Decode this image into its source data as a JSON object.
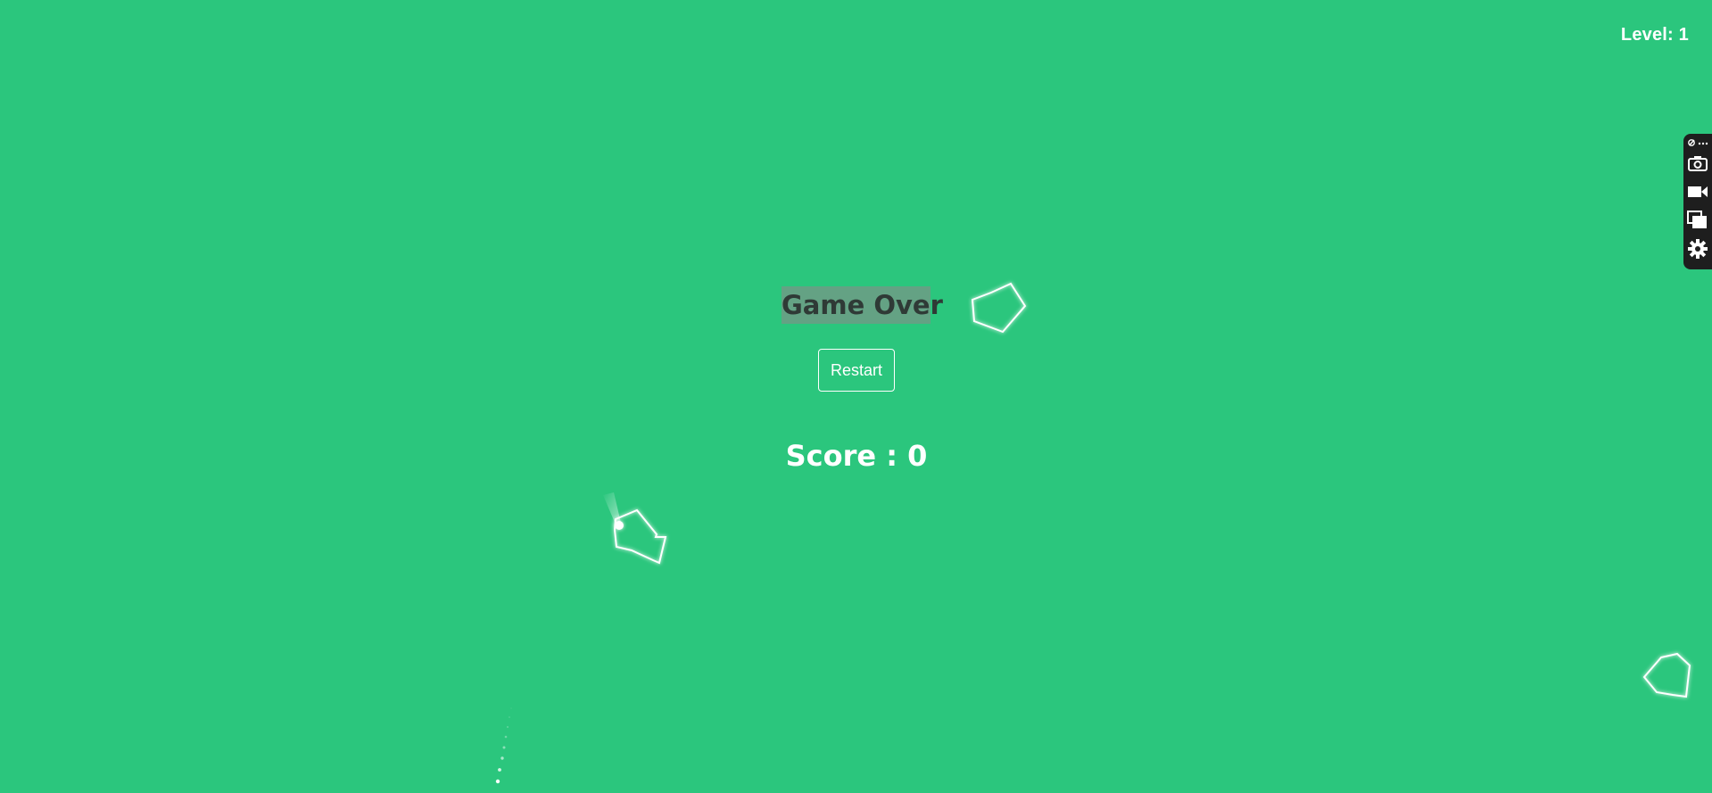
{
  "colors": {
    "background": "#2bc67d",
    "foreground": "#ffffff",
    "title_text": "#2f3a36",
    "title_highlight": "#7a9a88",
    "toolbar_bg": "#1e1e1e"
  },
  "hud": {
    "level_label": "Level: 1"
  },
  "game_over": {
    "title": "Game Over",
    "restart_label": "Restart",
    "score_text": "Score : 0"
  },
  "toolbar": {
    "items": [
      {
        "icon": "link-more-icon"
      },
      {
        "icon": "camera-icon"
      },
      {
        "icon": "video-camera-icon"
      },
      {
        "icon": "copy-windows-icon"
      },
      {
        "icon": "gear-icon"
      }
    ]
  }
}
